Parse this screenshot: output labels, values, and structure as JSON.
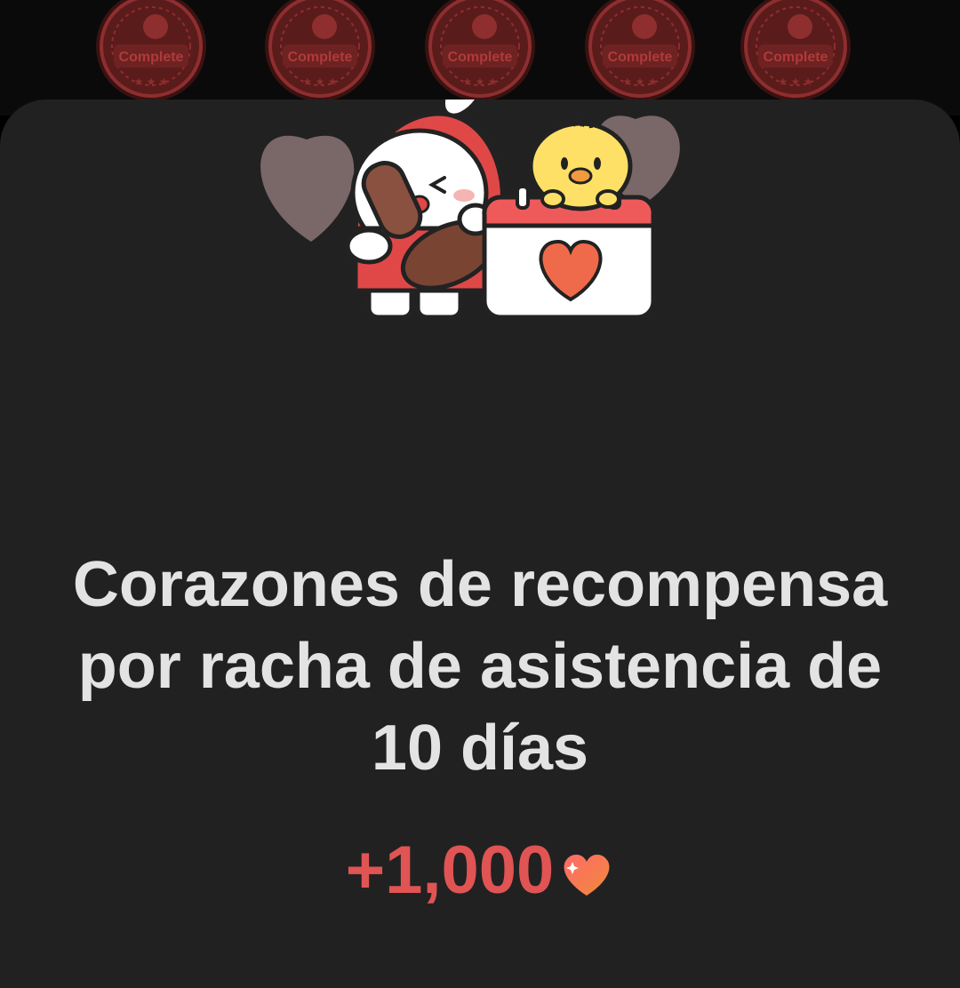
{
  "badges": [
    {
      "label": "Complete"
    },
    {
      "label": "Complete"
    },
    {
      "label": "Complete"
    },
    {
      "label": "Complete"
    },
    {
      "label": "Complete"
    }
  ],
  "dialog": {
    "title": "Corazones de recompensa por racha de asistencia de 10 días",
    "reward_amount": "+1,000",
    "reward_icon": "heart-icon"
  },
  "colors": {
    "background": "#212121",
    "title_text": "#e3e3e3",
    "reward_text": "#e05454",
    "badge": "#8e2e2e"
  }
}
